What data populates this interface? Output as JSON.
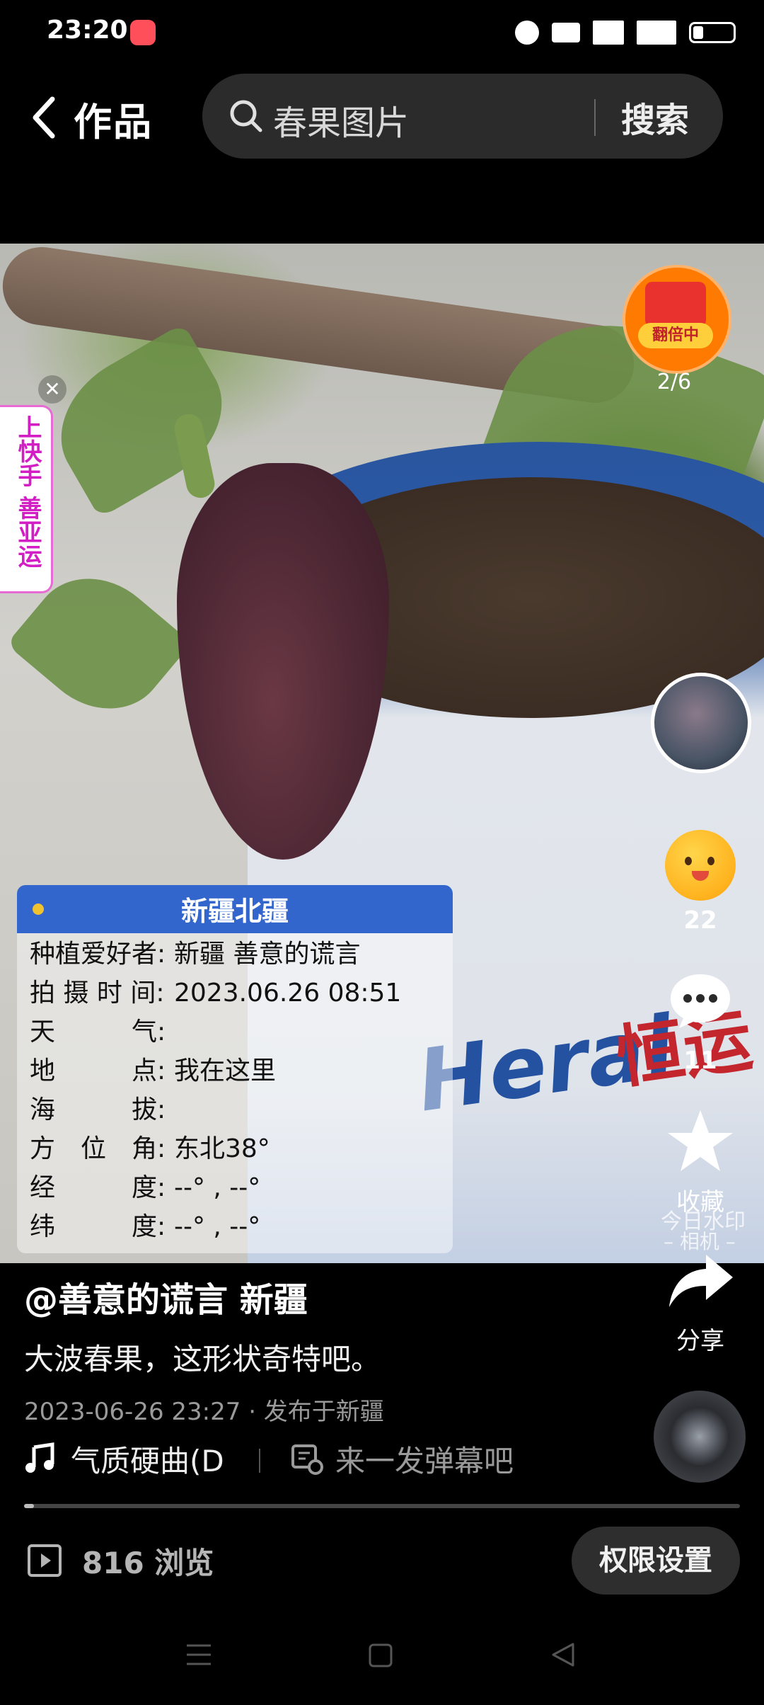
{
  "status_bar": {
    "time": "23:20"
  },
  "top_nav": {
    "back_label": "作品",
    "search_text": "春果图片",
    "search_button": "搜索"
  },
  "promo": {
    "text": "上快手 善亚运",
    "close": "✕"
  },
  "photo_card": {
    "title": "新疆北疆",
    "rows": [
      {
        "label": "种植爱好者:",
        "value": "新疆 善意的谎言"
      },
      {
        "label": "拍 摄 时 间:",
        "value": "2023.06.26 08:51"
      },
      {
        "label": "天　　　气:",
        "value": ""
      },
      {
        "label": "地　　　点:",
        "value": "我在这里"
      },
      {
        "label": "海　　　拔:",
        "value": ""
      },
      {
        "label": "方　位　角:",
        "value": "东北38°"
      },
      {
        "label": "经　　　度:",
        "value": "--° , --°"
      },
      {
        "label": "纬　　　度:",
        "value": "--° , --°"
      }
    ]
  },
  "photo_text": {
    "brand": "Heral",
    "brand_cn": "恒运"
  },
  "right_rail": {
    "badge_label": "翻倍中",
    "page_counter": "2/6",
    "like_count": "22",
    "comment_count": "11",
    "collect_label": "收藏",
    "share_label": "分享",
    "watermark_line1": "今日水印",
    "watermark_line2": "– 相机 –"
  },
  "post": {
    "author": "@善意的谎言 新疆",
    "description": "大波春果，这形状奇特吧。",
    "meta": "2023-06-26 23:27 · 发布于新疆",
    "music": "气质硬曲(D",
    "danmaku_placeholder": "来一发弹幕吧",
    "progress": 0.01
  },
  "footer": {
    "views": "816 浏览",
    "permission_button": "权限设置"
  },
  "colors": {
    "accent_blue": "#3366cc",
    "promo_pink": "#d21ec4",
    "badge_orange": "#ff7a00"
  }
}
